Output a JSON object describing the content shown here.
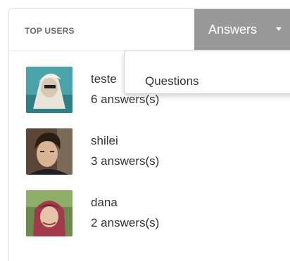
{
  "header": {
    "title": "TOP USERS",
    "dropdown_label": "Answers",
    "menu_items": [
      "Questions"
    ]
  },
  "users": [
    {
      "name": "teste",
      "count": "6 answers(s)"
    },
    {
      "name": "shilei",
      "count": "3 answers(s)"
    },
    {
      "name": "dana",
      "count": "2 answers(s)"
    }
  ],
  "colors": {
    "dropdown_bg": "#999999",
    "text": "#333333",
    "header_text": "#6b6b6b"
  }
}
